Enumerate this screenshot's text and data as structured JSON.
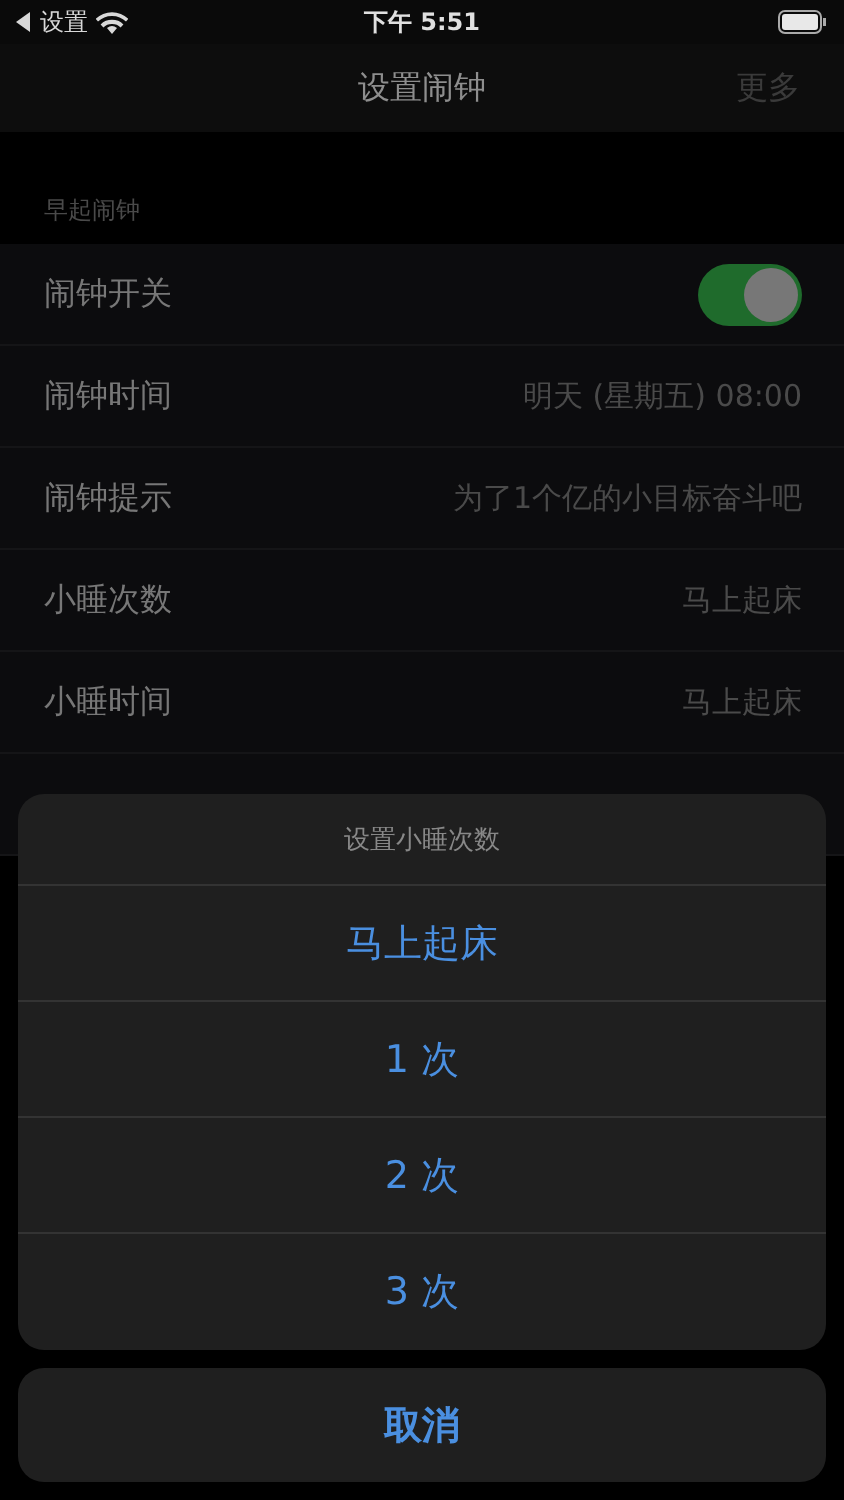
{
  "status_bar": {
    "back_label": "设置",
    "time": "下午 5:51"
  },
  "nav": {
    "title": "设置闹钟",
    "action": "更多"
  },
  "section": {
    "header": "早起闹钟"
  },
  "rows": [
    {
      "kind": "toggle",
      "label": "闹钟开关",
      "on": true
    },
    {
      "kind": "value",
      "label": "闹钟时间",
      "value": "明天 (星期五) 08:00"
    },
    {
      "kind": "value",
      "label": "闹钟提示",
      "value": "为了1个亿的小目标奋斗吧"
    },
    {
      "kind": "value",
      "label": "小睡次数",
      "value": "马上起床"
    },
    {
      "kind": "value",
      "label": "小睡时间",
      "value": "马上起床"
    }
  ],
  "action_sheet": {
    "title": "设置小睡次数",
    "options": [
      {
        "label": "马上起床"
      },
      {
        "label": "1 次"
      },
      {
        "label": "2 次"
      },
      {
        "label": "3 次"
      }
    ],
    "cancel": "取消"
  }
}
